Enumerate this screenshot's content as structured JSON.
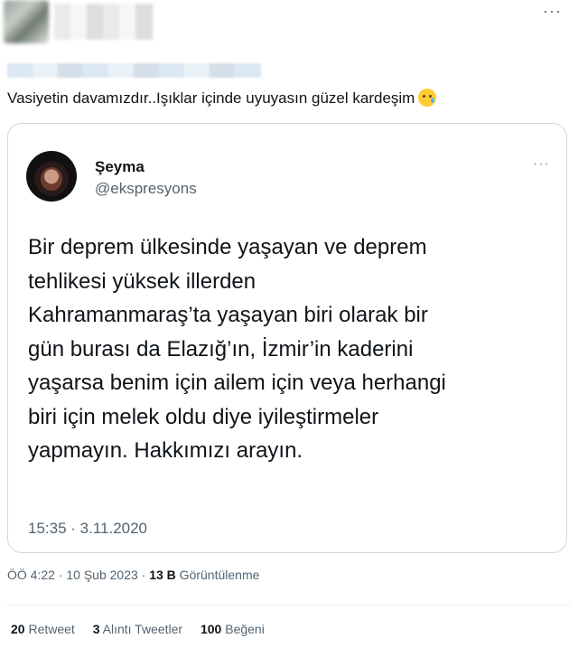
{
  "header": {
    "more_icon": "more-horizontal-icon"
  },
  "tweet": {
    "text": "Vasiyetin davamızdır..Işıklar içinde uyuyasın güzel kardeşim",
    "emoji": "crying-face-emoji"
  },
  "quoted": {
    "name": "Şeyma",
    "handle": "@ekspresyons",
    "more_icon": "more-horizontal-icon",
    "body": "Bir deprem ülkesinde yaşayan ve deprem\ntehlikesi yüksek illerden\nKahramanmaraş’ta yaşayan biri olarak bir\ngün burası da Elazığ’ın, İzmir’in kaderini\nyaşarsa benim için ailem için veya herhangi\nbiri için melek oldu diye iyileştirmeler\nyapmayın. Hakkımızı arayın.",
    "timestamp": "15:35 · 3.11.2020"
  },
  "meta": {
    "time": "ÖÖ 4:22 · 10 Şub 2023 · ",
    "views_count": "13 B",
    "views_label": " Görüntülenme"
  },
  "stats": {
    "retweets_count": "20",
    "retweets_label": " Retweet",
    "quotes_count": "3",
    "quotes_label": " Alıntı Tweetler",
    "likes_count": "100",
    "likes_label": " Beğeni"
  }
}
